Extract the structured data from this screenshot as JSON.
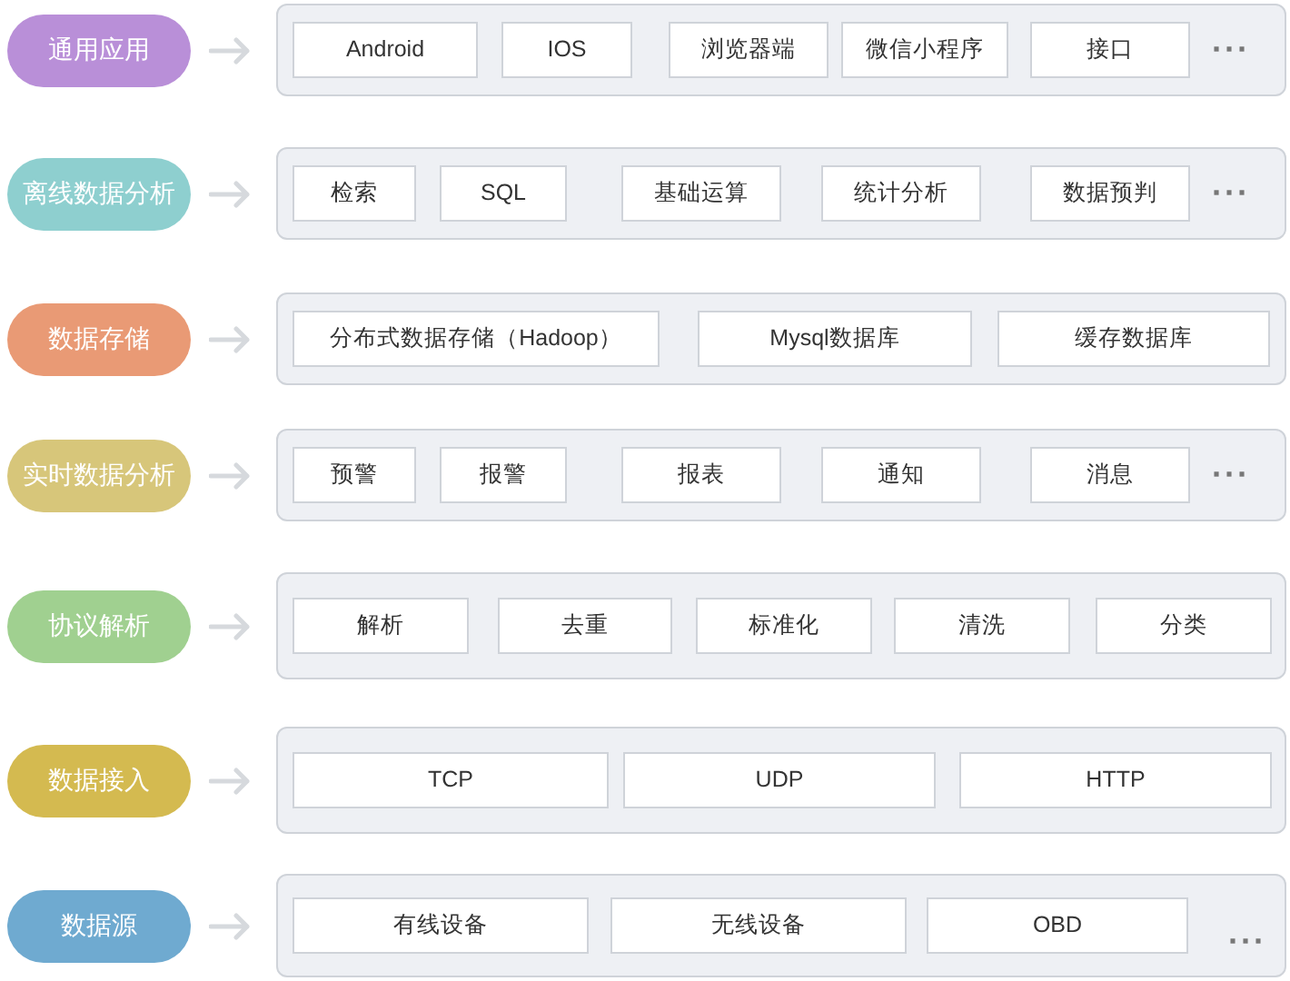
{
  "layers": [
    {
      "label": "通用应用",
      "color": "#b98fd8",
      "items": [
        "Android",
        "IOS",
        "浏览器端",
        "微信小程序",
        "接口"
      ],
      "more": "···"
    },
    {
      "label": "离线数据分析",
      "color": "#8ecfcf",
      "items": [
        "检索",
        "SQL",
        "基础运算",
        "统计分析",
        "数据预判"
      ],
      "more": "···"
    },
    {
      "label": "数据存储",
      "color": "#e99a75",
      "items": [
        "分布式数据存储（Hadoop）",
        "Mysql数据库",
        "缓存数据库"
      ]
    },
    {
      "label": "实时数据分析",
      "color": "#d7c67a",
      "items": [
        "预警",
        "报警",
        "报表",
        "通知",
        "消息"
      ],
      "more": "···"
    },
    {
      "label": "协议解析",
      "color": "#a0d090",
      "items": [
        "解析",
        "去重",
        "标准化",
        "清洗",
        "分类"
      ]
    },
    {
      "label": "数据接入",
      "color": "#d4ba50",
      "items": [
        "TCP",
        "UDP",
        "HTTP"
      ]
    },
    {
      "label": "数据源",
      "color": "#6faad0",
      "items": [
        "有线设备",
        "无线设备",
        "OBD"
      ],
      "more": "···"
    }
  ]
}
